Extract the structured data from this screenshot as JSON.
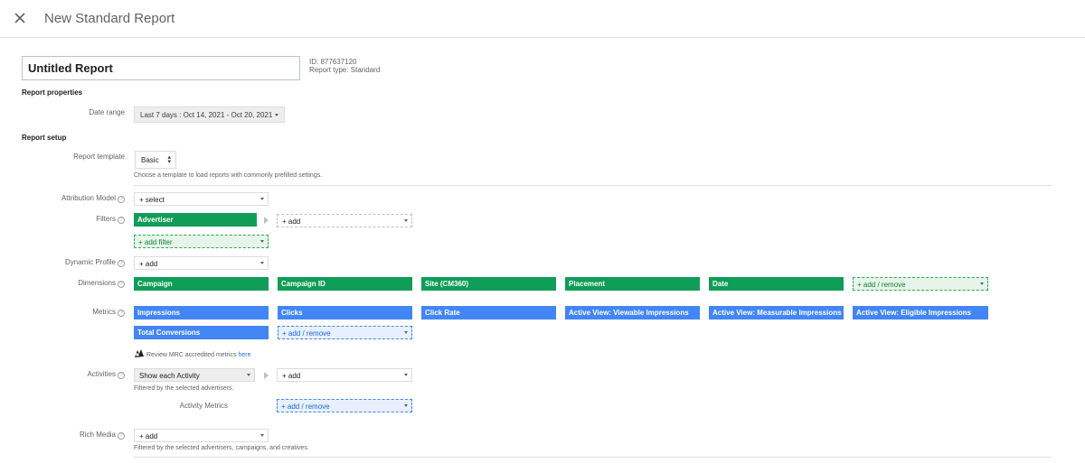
{
  "header": {
    "title": "New Standard Report"
  },
  "report": {
    "name": "Untitled Report",
    "id_text": "ID: 877637120",
    "type_text": "Report type: Standard"
  },
  "properties": {
    "section_title": "Report properties",
    "date_range_label": "Date range",
    "date_range_value": "Last 7 days : Oct 14, 2021 - Oct 20, 2021"
  },
  "setup": {
    "section_title": "Report setup",
    "template_label": "Report template",
    "template_value": "Basic",
    "template_hint": "Choose a template to load reports with commonly prefilled settings.",
    "attribution_label": "Attribution Model",
    "attribution_value": "+ select",
    "filters_label": "Filters",
    "filters_chip": "Advertiser",
    "filters_add": "+ add",
    "add_filter": "+ add filter",
    "dynamic_label": "Dynamic Profile",
    "dynamic_value": "+ add",
    "dimensions_label": "Dimensions",
    "dimensions": [
      "Campaign",
      "Campaign ID",
      "Site (CM360)",
      "Placement",
      "Date"
    ],
    "dimensions_add": "+ add / remove",
    "metrics_label": "Metrics",
    "metrics": [
      "Impressions",
      "Clicks",
      "Click Rate",
      "Active View: Viewable Impressions",
      "Active View: Measurable Impressions",
      "Active View: Eligible Impressions",
      "Total Conversions"
    ],
    "metrics_add": "+ add / remove",
    "mrc_text": "Review MRC accredited metrics",
    "mrc_link": "here",
    "activities_label": "Activities",
    "activities_value": "Show each Activity",
    "activities_add": "+ add",
    "activities_hint": "Filtered by the selected advertisers.",
    "activity_metrics_label": "Activity Metrics",
    "activity_metrics_add": "+ add / remove",
    "rich_media_label": "Rich Media",
    "rich_media_value": "+ add",
    "rich_media_hint": "Filtered by the selected advertisers, campaigns, and creatives."
  },
  "colors": {
    "green": "#0f9d58",
    "blue": "#4285f4"
  },
  "icons": {
    "close": "close-icon",
    "help": "help-icon",
    "mrc": "mrc-badge-icon"
  }
}
